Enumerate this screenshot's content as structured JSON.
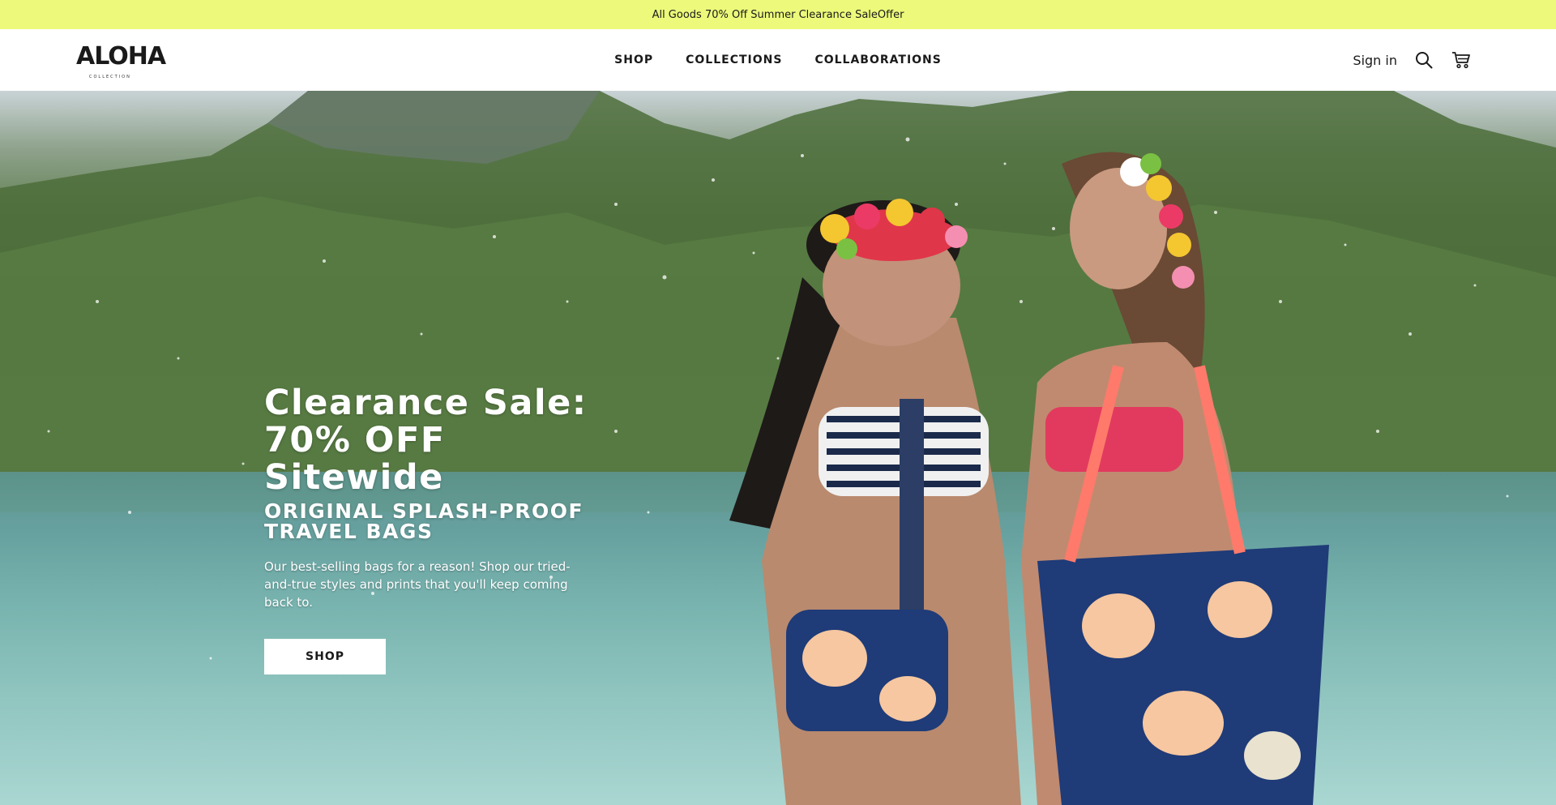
{
  "announcement": {
    "text": "All Goods 70% Off Summer Clearance SaleOffer"
  },
  "header": {
    "logo_text": "ALOHA",
    "logo_subtext": "COLLECTION",
    "nav": [
      {
        "label": "SHOP"
      },
      {
        "label": "COLLECTIONS"
      },
      {
        "label": "COLLABORATIONS"
      }
    ],
    "signin_label": "Sign in",
    "icons": [
      "search-icon",
      "cart-icon"
    ]
  },
  "hero": {
    "title_lines": [
      "Clearance Sale:",
      "70% OFF",
      "Sitewide"
    ],
    "subtitle_lines": [
      "ORIGINAL SPLASH-PROOF",
      "TRAVEL BAGS"
    ],
    "description": "Our best-selling bags for a reason! Shop our tried-and-true styles and prints that you'll keep coming back to.",
    "button_label": "SHOP"
  },
  "colors": {
    "announcement_bg": "#ecf97a",
    "header_bg": "#ffffff",
    "text_dark": "#1a1a1a",
    "hero_text": "#ffffff"
  }
}
